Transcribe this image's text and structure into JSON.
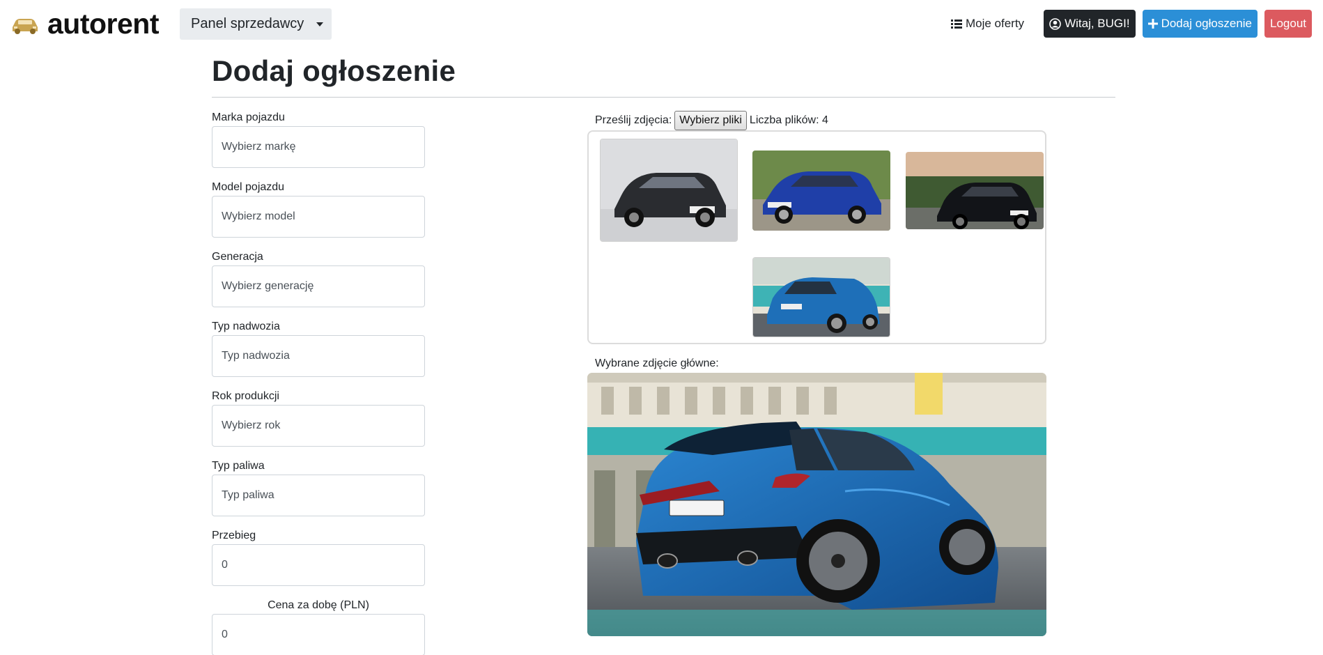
{
  "navbar": {
    "brand": "autorent",
    "panel_dropdown": "Panel sprzedawcy",
    "my_offers": "Moje oferty",
    "greeting": "Witaj, BUGI!",
    "add_listing": "Dodaj ogłoszenie",
    "logout": "Logout"
  },
  "page": {
    "title": "Dodaj ogłoszenie"
  },
  "form": {
    "fields": [
      {
        "label": "Marka pojazdu",
        "value": "Wybierz markę"
      },
      {
        "label": "Model pojazdu",
        "value": "Wybierz model"
      },
      {
        "label": "Generacja",
        "value": "Wybierz generację"
      },
      {
        "label": "Typ nadwozia",
        "value": "Typ nadwozia"
      },
      {
        "label": "Rok produkcji",
        "value": "Wybierz rok"
      },
      {
        "label": "Typ paliwa",
        "value": "Typ paliwa"
      },
      {
        "label": "Przebieg",
        "value": "0"
      },
      {
        "label": "Cena za dobę (PLN)",
        "value": "0"
      }
    ]
  },
  "upload": {
    "label": "Prześlij zdjęcia:",
    "button": "Wybierz pliki",
    "count": "Liczba plików: 4"
  },
  "main_photo": {
    "label": "Wybrane zdjęcie główne:"
  },
  "colors": {
    "primary": "#2b8fd7",
    "danger": "#dc5a5f",
    "dark": "#212529",
    "car_blue": "#1e6fb8"
  }
}
